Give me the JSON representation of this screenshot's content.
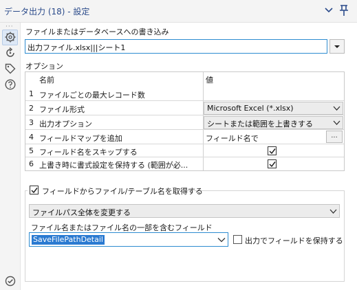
{
  "window": {
    "title": "データ出力 (18) - 設定"
  },
  "output_section": {
    "label": "ファイルまたはデータベースへの書き込み",
    "value": "出力ファイル.xlsx|||シート1"
  },
  "options": {
    "label": "オプション",
    "col_name": "名前",
    "col_value": "値",
    "rows": [
      {
        "num": "1",
        "name": "ファイルごとの最大レコード数",
        "value": ""
      },
      {
        "num": "2",
        "name": "ファイル形式",
        "value": "Microsoft Excel (*.xlsx)"
      },
      {
        "num": "3",
        "name": "出力オプション",
        "value": "シートまたは範囲を上書きする"
      },
      {
        "num": "4",
        "name": "フィールドマップを追加",
        "value": "フィールド名で",
        "button": "..."
      },
      {
        "num": "5",
        "name": "フィールド名をスキップする",
        "checked": true
      },
      {
        "num": "6",
        "name": "上書き時に書式設定を保持する (範囲が必...",
        "checked": true
      }
    ]
  },
  "filename_group": {
    "checkbox_label": "フィールドからファイル/テーブル名を取得する",
    "checked": true,
    "mode_value": "ファイルパス全体を変更する",
    "field_label": "ファイル名またはファイル名の一部を含むフィールド",
    "field_value": "SaveFilePathDetail",
    "keep_label": "出力でフィールドを保持する",
    "keep_checked": false
  },
  "icons": {
    "sidebar": [
      "gear-icon",
      "refresh-icon",
      "tag-icon",
      "help-icon"
    ],
    "bottom": "check-circle-icon",
    "accent": "#2c8bd0",
    "title_color": "#2a4a8a"
  }
}
